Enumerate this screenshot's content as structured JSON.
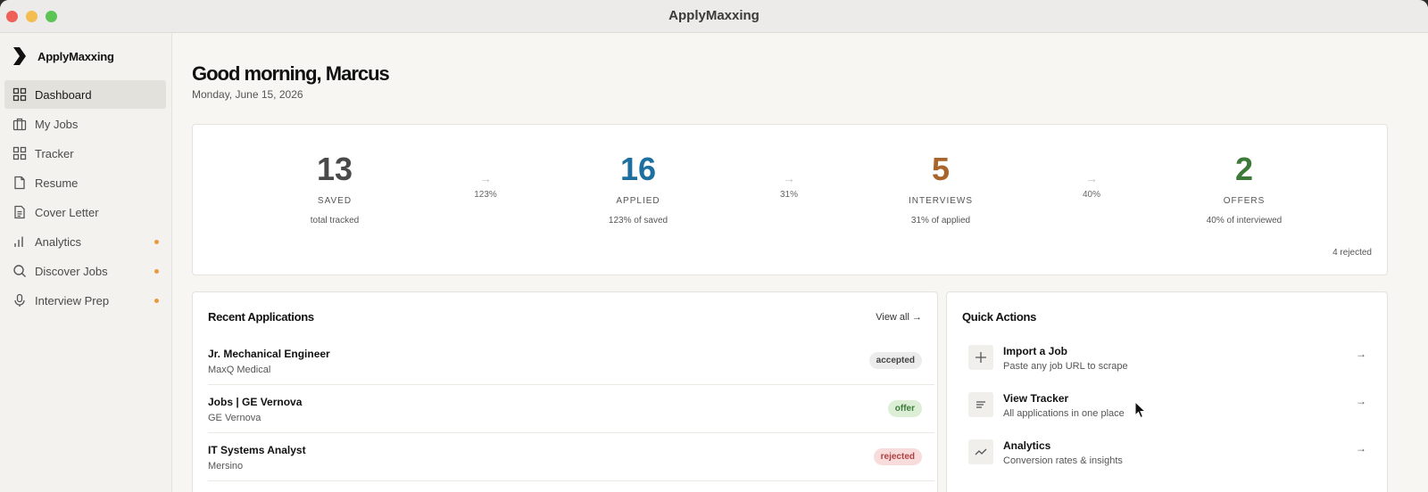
{
  "window": {
    "title": "ApplyMaxxing"
  },
  "sidebar": {
    "brand": "ApplyMaxxing",
    "items": [
      {
        "label": "Dashboard",
        "icon": "grid-icon",
        "active": true,
        "dot": false
      },
      {
        "label": "My Jobs",
        "icon": "briefcase-icon",
        "active": false,
        "dot": false
      },
      {
        "label": "Tracker",
        "icon": "board-icon",
        "active": false,
        "dot": false
      },
      {
        "label": "Resume",
        "icon": "document-icon",
        "active": false,
        "dot": false
      },
      {
        "label": "Cover Letter",
        "icon": "letter-icon",
        "active": false,
        "dot": false
      },
      {
        "label": "Analytics",
        "icon": "bar-chart-icon",
        "active": false,
        "dot": true
      },
      {
        "label": "Discover Jobs",
        "icon": "search-icon",
        "active": false,
        "dot": true
      },
      {
        "label": "Interview Prep",
        "icon": "microphone-icon",
        "active": false,
        "dot": true
      }
    ],
    "dot_color": "#e99a3d"
  },
  "header": {
    "greeting": "Good morning, Marcus",
    "date": "Monday, June 15, 2026"
  },
  "stats": {
    "items": [
      {
        "value": "13",
        "label": "SAVED",
        "sub": "total tracked",
        "color": "#4a4a4a"
      },
      {
        "value": "16",
        "label": "APPLIED",
        "sub": "123% of saved",
        "color": "#1d6fa0"
      },
      {
        "value": "5",
        "label": "INTERVIEWS",
        "sub": "31% of applied",
        "color": "#a8642a"
      },
      {
        "value": "2",
        "label": "OFFERS",
        "sub": "40% of interviewed",
        "color": "#3d7a3a"
      }
    ],
    "conversions": [
      {
        "arrow": "→",
        "pct": "123%"
      },
      {
        "arrow": "→",
        "pct": "31%"
      },
      {
        "arrow": "→",
        "pct": "40%"
      }
    ],
    "rejected": "4 rejected"
  },
  "recent": {
    "title": "Recent Applications",
    "view_all": "View all →",
    "rows": [
      {
        "title": "Jr. Mechanical Engineer",
        "company": "MaxQ Medical",
        "status": "accepted",
        "bg": "#ececec",
        "fg": "#444"
      },
      {
        "title": "Jobs | GE Vernova",
        "company": "GE Vernova",
        "status": "offer",
        "bg": "#dcefd6",
        "fg": "#3d7a3a"
      },
      {
        "title": "IT Systems Analyst",
        "company": "Mersino",
        "status": "rejected",
        "bg": "#f8dcdc",
        "fg": "#b04040"
      }
    ]
  },
  "quick_actions": {
    "title": "Quick Actions",
    "items": [
      {
        "title": "Import a Job",
        "desc": "Paste any job URL to scrape",
        "icon": "plus-icon",
        "arrow": "→"
      },
      {
        "title": "View Tracker",
        "desc": "All applications in one place",
        "icon": "list-icon",
        "arrow": "→"
      },
      {
        "title": "Analytics",
        "desc": "Conversion rates & insights",
        "icon": "trend-icon",
        "arrow": "→"
      }
    ]
  }
}
